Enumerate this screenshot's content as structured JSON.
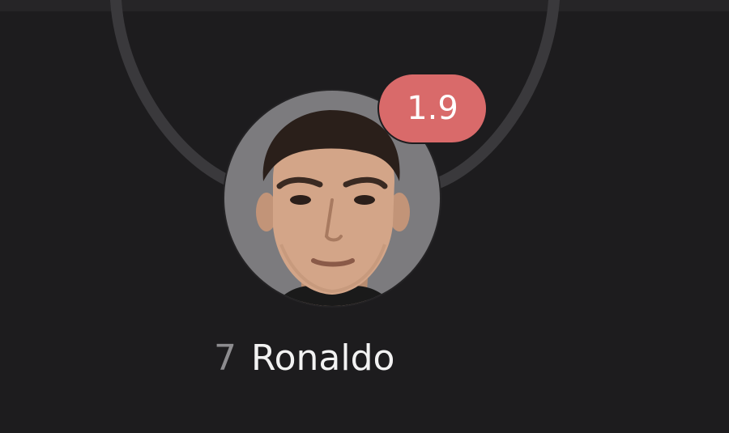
{
  "player": {
    "rating": "1.9",
    "number": "7",
    "name": "Ronaldo",
    "photo": "player-portrait-icon"
  },
  "colors": {
    "background": "#1d1c1e",
    "pitch_line": "#3a393c",
    "avatar_bg": "#7c7b7e",
    "rating_badge": "#d96a6a",
    "name_text": "#f2f2f2",
    "number_text": "#8d8c8f"
  }
}
